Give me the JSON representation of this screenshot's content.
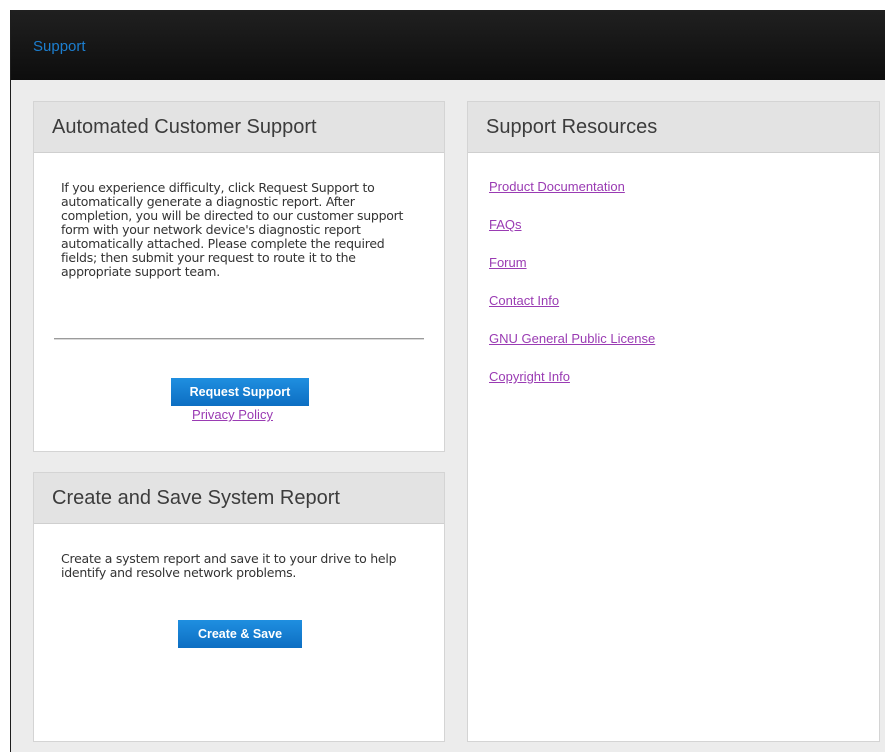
{
  "header": {
    "title": "Support"
  },
  "automated_support": {
    "title": "Automated Customer Support",
    "description": "If you experience difficulty, click Request Support to automatically generate a diagnostic report. After completion, you will be directed to our customer support form with your network device's diagnostic report automatically attached. Please complete the required fields; then submit your request to route it to the appropriate support team.",
    "button_label": "Request Support",
    "privacy_link": "Privacy Policy"
  },
  "system_report": {
    "title": "Create and Save System Report",
    "description": "Create a system report and save it to your drive to help identify and resolve network problems.",
    "button_label": "Create & Save"
  },
  "resources": {
    "title": "Support Resources",
    "links": [
      "Product Documentation",
      "FAQs",
      "Forum",
      "Contact Info",
      "GNU General Public License",
      "Copyright Info"
    ]
  },
  "colors": {
    "topbar": "#0d0d0d",
    "accent_blue": "#1c7ecf",
    "button_blue": "#0d6ec2",
    "link_purple": "#9a3bb3",
    "panel_header": "#e3e3e3",
    "background": "#ececec"
  }
}
